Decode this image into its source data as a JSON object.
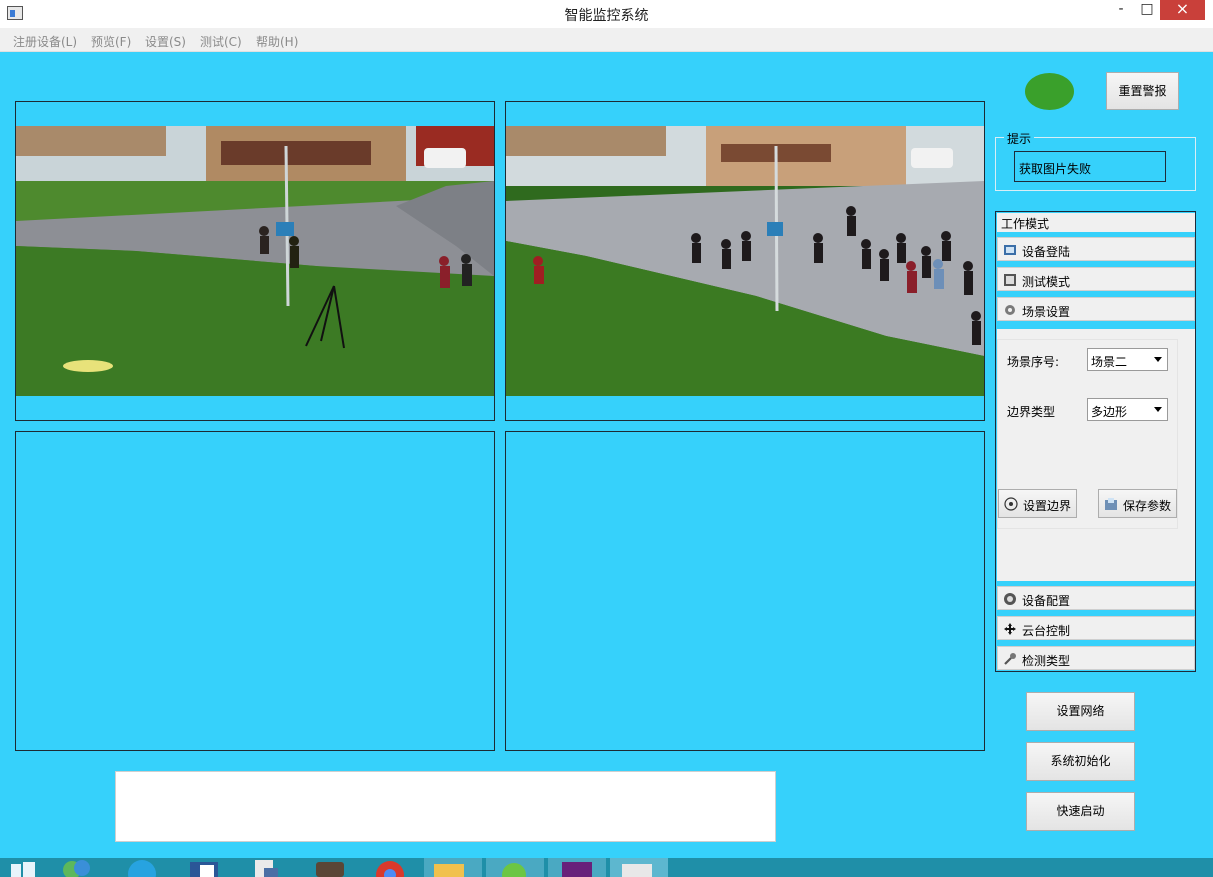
{
  "window": {
    "title": "智能监控系统",
    "minimize": "-",
    "maximize": "□",
    "close": "×"
  },
  "menu": [
    "注册设备(L)",
    "预览(F)",
    "设置(S)",
    "测试(C)",
    "帮助(H)"
  ],
  "status": {
    "led_color": "#3aa02b",
    "reset_alarm_label": "重置警报"
  },
  "hint": {
    "legend": "提示",
    "message": "获取图片失败"
  },
  "toolbox": {
    "header": "工作模式",
    "tabs_top": [
      {
        "label": "设备登陆",
        "icon": "login-icon"
      },
      {
        "label": "测试模式",
        "icon": "test-mode-icon"
      },
      {
        "label": "场景设置",
        "icon": "gear-icon"
      }
    ],
    "scene": {
      "number_label": "场景序号:",
      "number_value": "场景二",
      "boundary_label": "边界类型",
      "boundary_value": "多边形",
      "set_boundary_label": "设置边界",
      "save_params_label": "保存参数"
    },
    "tabs_bottom": [
      {
        "label": "设备配置",
        "icon": "camera-icon"
      },
      {
        "label": "云台控制",
        "icon": "move-arrows-icon"
      },
      {
        "label": "检测类型",
        "icon": "wrench-icon"
      }
    ]
  },
  "actions": {
    "network": "设置网络",
    "init": "系统初始化",
    "quick_start": "快速启动"
  },
  "colors": {
    "background": "#36d1fb",
    "grass": "#3c7a24",
    "road": "#8d8f95",
    "building": "#b08a63"
  }
}
